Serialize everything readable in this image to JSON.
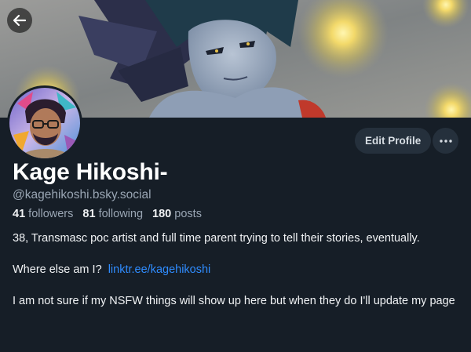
{
  "header": {
    "back_icon": "arrow-left-icon"
  },
  "profile": {
    "display_name": "Kage Hikoshi-",
    "handle": "@kagehikoshi.bsky.social",
    "followers_count": "41",
    "followers_label": "followers",
    "following_count": "81",
    "following_label": "following",
    "posts_count": "180",
    "posts_label": "posts"
  },
  "actions": {
    "edit_profile_label": "Edit Profile",
    "more_icon": "ellipsis-icon"
  },
  "bio": {
    "line1": "38, Transmasc poc artist and full time parent trying to tell their stories, eventually.",
    "where_prefix": "Where else am I?",
    "link_text": "linktr.ee/kagehikoshi",
    "line3": "I am not sure if my NSFW things will show up here but when they do I'll update my page"
  },
  "colors": {
    "background": "#161e27",
    "link": "#2f8cff",
    "button_bg": "#25303c",
    "muted_text": "#9aa6b4"
  }
}
